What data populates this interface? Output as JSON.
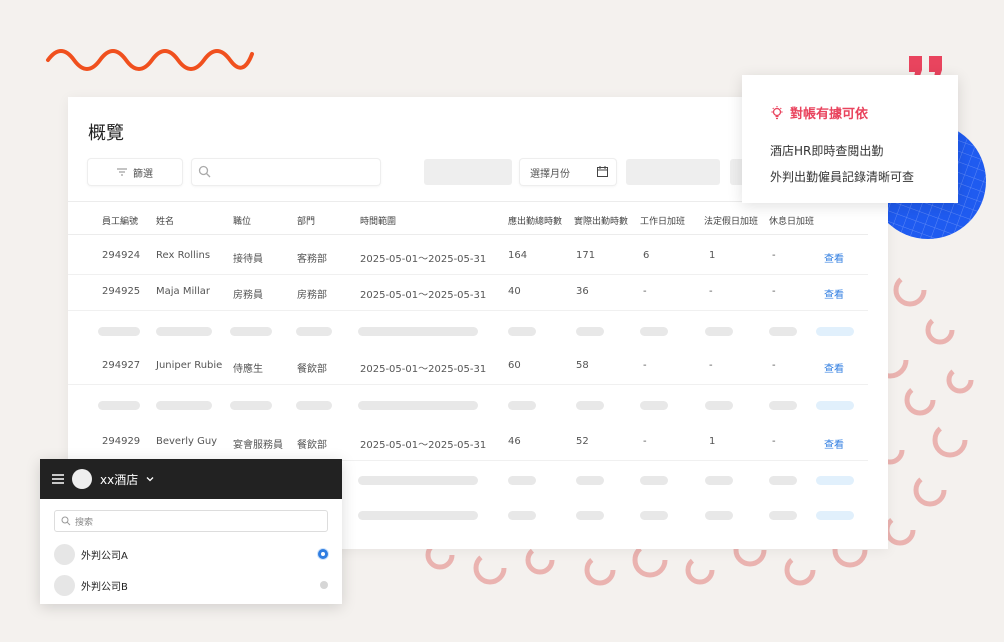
{
  "page": {
    "title": "概覽",
    "filter_label": "篩選",
    "month_placeholder": "選擇月份"
  },
  "table": {
    "columns": [
      "員工編號",
      "姓名",
      "職位",
      "部門",
      "時間範圍",
      "應出勤總時數",
      "實際出勤時數",
      "工作日加班",
      "法定假日加班",
      "休息日加班"
    ],
    "rows": [
      {
        "id": "294924",
        "name": "Rex Rollins",
        "position": "接待員",
        "dept": "客務部",
        "range": "2025-05-01～2025-05-31",
        "required": "164",
        "actual": "171",
        "weekday_ot": "6",
        "holiday_ot": "1",
        "rest_ot": "-",
        "action": "查看"
      },
      {
        "id": "294925",
        "name": "Maja Millar",
        "position": "房務員",
        "dept": "房務部",
        "range": "2025-05-01～2025-05-31",
        "required": "40",
        "actual": "36",
        "weekday_ot": "-",
        "holiday_ot": "-",
        "rest_ot": "-",
        "action": "查看"
      },
      {
        "id": "294927",
        "name": "Juniper Rubie",
        "position": "侍應生",
        "dept": "餐飲部",
        "range": "2025-05-01～2025-05-31",
        "required": "60",
        "actual": "58",
        "weekday_ot": "-",
        "holiday_ot": "-",
        "rest_ot": "-",
        "action": "查看"
      },
      {
        "id": "294929",
        "name": "Beverly Guy",
        "position": "宴會服務員",
        "dept": "餐飲部",
        "range": "2025-05-01～2025-05-31",
        "required": "46",
        "actual": "52",
        "weekday_ot": "-",
        "holiday_ot": "1",
        "rest_ot": "-",
        "action": "查看"
      }
    ]
  },
  "popup": {
    "heading": "對帳有據可依",
    "lines": [
      "酒店HR即時查閱出勤",
      "外判出勤僱員記錄清晰可查"
    ]
  },
  "dropdown": {
    "hotel": "xx酒店",
    "search_placeholder": "搜索",
    "items": [
      {
        "label": "外判公司A",
        "selected": true
      },
      {
        "label": "外判公司B",
        "selected": false
      }
    ]
  },
  "colors": {
    "accent_red": "#e9445e",
    "accent_blue": "#2f7de1",
    "squiggle": "#f0501e",
    "disc_blue": "#1f5bf0"
  }
}
